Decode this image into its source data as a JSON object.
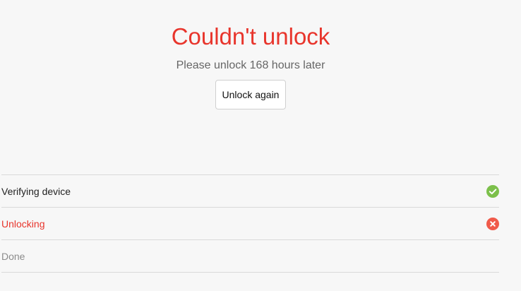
{
  "result": {
    "title": "Couldn't unlock",
    "message": "Please unlock 168 hours later",
    "retry_label": "Unlock again"
  },
  "steps": [
    {
      "label": "Verifying device",
      "status": "success",
      "icon": "check-circle-icon"
    },
    {
      "label": "Unlocking",
      "status": "failed",
      "icon": "x-circle-icon"
    },
    {
      "label": "Done",
      "status": "pending",
      "icon": ""
    }
  ],
  "colors": {
    "error": "#e8352c",
    "success": "#7cc04b",
    "failure_icon": "#f05a4a",
    "pending_text": "#8c8c8c",
    "background": "#f7f7f7"
  }
}
